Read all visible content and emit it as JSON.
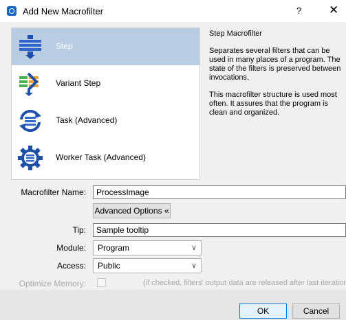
{
  "window": {
    "title": "Add New Macrofilter",
    "help": "?",
    "close": "✕"
  },
  "list": {
    "items": [
      {
        "label": "Step",
        "icon": "step-icon",
        "selected": true
      },
      {
        "label": "Variant Step",
        "icon": "variant-step-icon",
        "selected": false
      },
      {
        "label": "Task (Advanced)",
        "icon": "task-icon",
        "selected": false
      },
      {
        "label": "Worker Task (Advanced)",
        "icon": "worker-task-icon",
        "selected": false
      }
    ]
  },
  "description": {
    "title": "Step Macrofilter",
    "p1": "Separates several filters that can be used in many places of a program. The state of the filters is preserved between invocations.",
    "p2": "This macrofilter structure is used most often. It assures that the program is clean and organized."
  },
  "form": {
    "name_label": "Macrofilter Name:",
    "name_value": "ProcessImage",
    "advanced_label": "Advanced Options «",
    "tip_label": "Tip:",
    "tip_value": "Sample tooltip",
    "module_label": "Module:",
    "module_value": "Program",
    "access_label": "Access:",
    "access_value": "Public",
    "optimize_label": "Optimize Memory:",
    "optimize_checked": false,
    "optimize_hint": "(if checked, filters' output data are released after last iteration)"
  },
  "footer": {
    "ok_label": "OK",
    "cancel_label": "Cancel"
  },
  "colors": {
    "selection": "#b8cde4",
    "accent_blue": "#1f4fa8",
    "accent_green": "#4caf50",
    "accent_orange": "#f0a030"
  }
}
